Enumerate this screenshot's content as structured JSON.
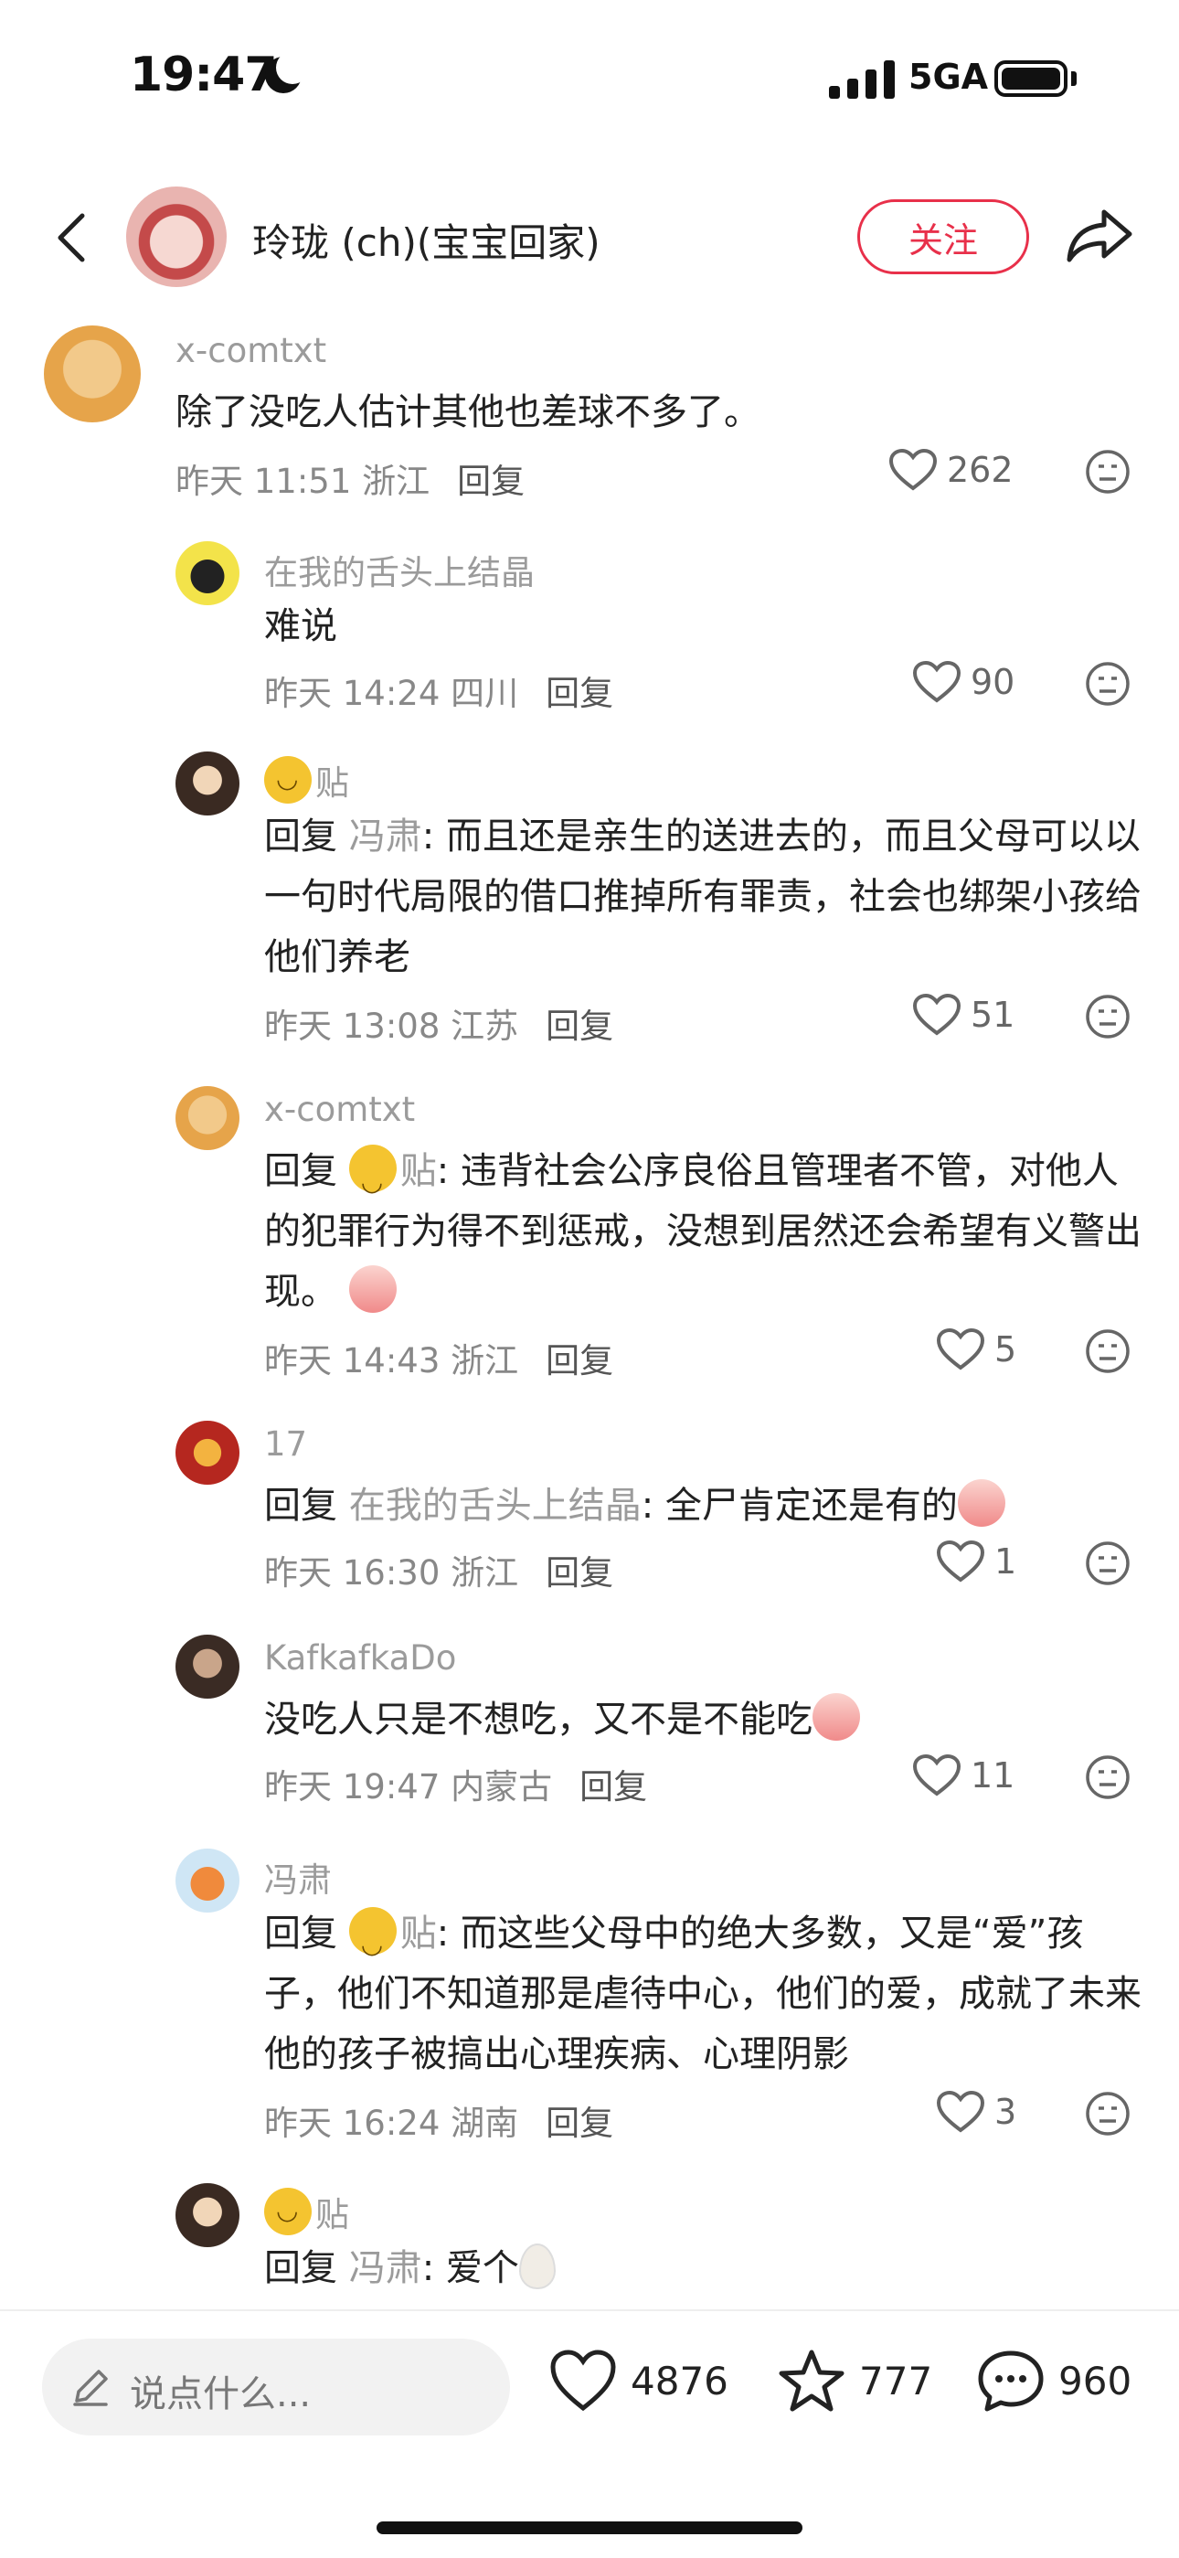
{
  "status_bar": {
    "time": "19:47",
    "network": "5GA"
  },
  "header": {
    "user_name": "玲珑 (ch)(宝宝回家)",
    "follow_label": "关注"
  },
  "comments": [
    {
      "user": "x-comtxt",
      "text": "除了没吃人估计其他也差球不多了。",
      "time": "昨天 11:51 浙江",
      "reply_label": "回复",
      "likes": "262"
    },
    {
      "user": "在我的舌头上结晶",
      "text": "难说",
      "time": "昨天 14:24 四川",
      "reply_label": "回复",
      "likes": "90"
    },
    {
      "user": "贴",
      "reply_prefix": "回复 ",
      "reply_to": "冯肃",
      "text": ": 而且还是亲生的送进去的，而且父母可以以一句时代局限的借口推掉所有罪责，社会也绑架小孩给他们养老",
      "time": "昨天 13:08 江苏",
      "reply_label": "回复",
      "likes": "51"
    },
    {
      "user": "x-comtxt",
      "reply_prefix": "回复 ",
      "reply_to": "贴",
      "text": ": 违背社会公序良俗且管理者不管，对他人的犯罪行为得不到惩戒，没想到居然还会希望有义警出现。",
      "time": "昨天 14:43 浙江",
      "reply_label": "回复",
      "likes": "5"
    },
    {
      "user": "17",
      "reply_prefix": "回复 ",
      "reply_to": "在我的舌头上结晶",
      "text": ": 全尸肯定还是有的",
      "time": "昨天 16:30 浙江",
      "reply_label": "回复",
      "likes": "1"
    },
    {
      "user": "KafkafkaDo",
      "text": "没吃人只是不想吃，又不是不能吃",
      "time": "昨天 19:47 内蒙古",
      "reply_label": "回复",
      "likes": "11"
    },
    {
      "user": "冯肃",
      "reply_prefix": "回复 ",
      "reply_to": "贴",
      "text": ": 而这些父母中的绝大多数，又是“爱”孩子，他们不知道那是虐待中心，他们的爱，成就了未来他的孩子被搞出心理疾病、心理阴影",
      "time": "昨天 16:24 湖南",
      "reply_label": "回复",
      "likes": "3"
    },
    {
      "user": "贴",
      "reply_prefix": "回复 ",
      "reply_to": "冯肃",
      "text": ": 爱个"
    }
  ],
  "bottom_bar": {
    "placeholder": "说点什么...",
    "likes": "4876",
    "favorites": "777",
    "comments": "960"
  },
  "colors": {
    "accent": "#e8304a",
    "muted": "#9b9b9b"
  }
}
